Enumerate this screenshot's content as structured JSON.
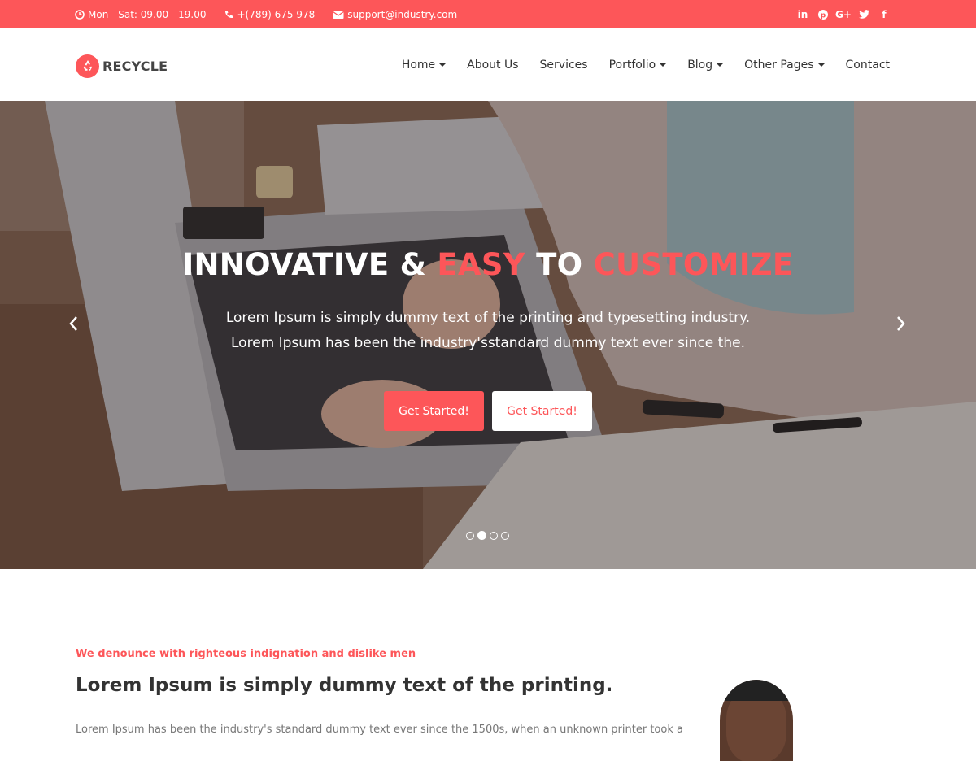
{
  "topbar": {
    "hours": "Mon - Sat: 09.00 - 19.00",
    "phone": "+(789) 675 978",
    "email": "support@industry.com",
    "social_icons": [
      "linkedin-icon",
      "pinterest-icon",
      "google-plus-icon",
      "twitter-icon",
      "facebook-icon"
    ],
    "social_labels": [
      "in",
      "p",
      "G+",
      "t",
      "f"
    ],
    "bg_color": "#fd5659"
  },
  "header": {
    "logo_text": "RECYCLE",
    "nav": [
      {
        "label": "Home",
        "dropdown": true
      },
      {
        "label": "About Us",
        "dropdown": false
      },
      {
        "label": "Services",
        "dropdown": false
      },
      {
        "label": "Portfolio",
        "dropdown": true
      },
      {
        "label": "Blog",
        "dropdown": true
      },
      {
        "label": "Other Pages",
        "dropdown": true
      },
      {
        "label": "Contact",
        "dropdown": false
      }
    ]
  },
  "hero": {
    "title_part1": "INNOVATIVE & ",
    "title_accent1": "EASY",
    "title_part2": " TO ",
    "title_accent2": "CUSTOMIZE",
    "subtitle_line1": "Lorem Ipsum is simply dummy text of the printing and typesetting industry.",
    "subtitle_line2": "Lorem Ipsum has been the industry'sstandard dummy text ever since the.",
    "button_primary": "Get Started!",
    "button_secondary": "Get Started!",
    "slide_count": 4,
    "active_slide": 2,
    "accent_color": "#fd5659"
  },
  "about": {
    "kicker": "We denounce with righteous indignation and dislike men",
    "title": "Lorem Ipsum is simply dummy text of the printing.",
    "text": "Lorem Ipsum has been the industry's standard dummy text ever since the 1500s, when an unknown printer took a"
  }
}
